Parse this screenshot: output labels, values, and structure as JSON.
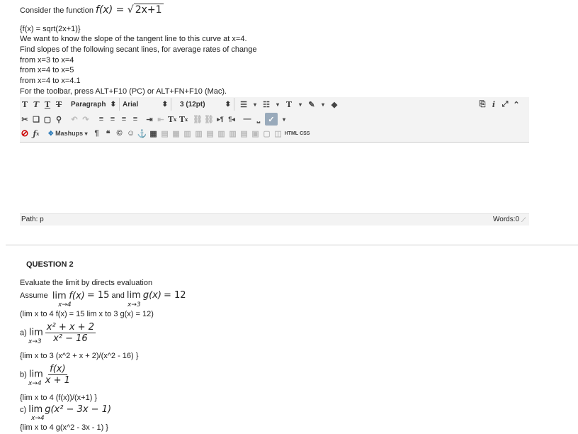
{
  "q1": {
    "intro": "Consider the function",
    "func_lhs": "f(x) = ",
    "func_rad": "2x+1",
    "latex": "{f(x) = sqrt(2x+1)}",
    "line1": "We want to know the slope of the tangent line to this curve at x=4.",
    "line2": "Find slopes of the following secant lines, for average rates of change",
    "item1": "from x=3 to x=4",
    "item2": "from x=4 to x=5",
    "item3": "from x=4 to x=4.1",
    "toolbar_hint": "For the toolbar, press ALT+F10 (PC) or ALT+FN+F10 (Mac)."
  },
  "editor": {
    "format_select": "Paragraph",
    "font_select": "Arial",
    "size_select": "3 (12pt)",
    "mashups_label": "Mashups",
    "html_label": "HTML",
    "css_label": "CSS",
    "path_label": "Path: p",
    "words_label": "Words:0"
  },
  "q2": {
    "title": "QUESTION 2",
    "instruction": "Evaluate the limit by directs evaluation",
    "assume": "Assume",
    "lim": "lim",
    "fx": "f(x)",
    "eq15": "= 15",
    "and": "and",
    "gx": "g(x)",
    "eq12": "= 12",
    "sub4": "x→4",
    "sub3": "x→3",
    "latex_assume": "(lim x to 4 f(x) = 15    lim x to 3 g(x) = 12)",
    "a_label": "a)",
    "a_num": "x² + x + 2",
    "a_den": "x² − 16",
    "a_latex": "{lim  x to 3  (x^2 + x + 2)/(x^2 - 16) }",
    "b_label": "b)",
    "b_num": "f(x)",
    "b_den": "x + 1",
    "b_latex": "{lim  x to 4 (f(x))/(x+1) }",
    "c_label": "c)",
    "c_expr": "g(x² − 3x − 1)",
    "c_latex": "{lim  x to  4  g(x^2 - 3x - 1) }"
  }
}
